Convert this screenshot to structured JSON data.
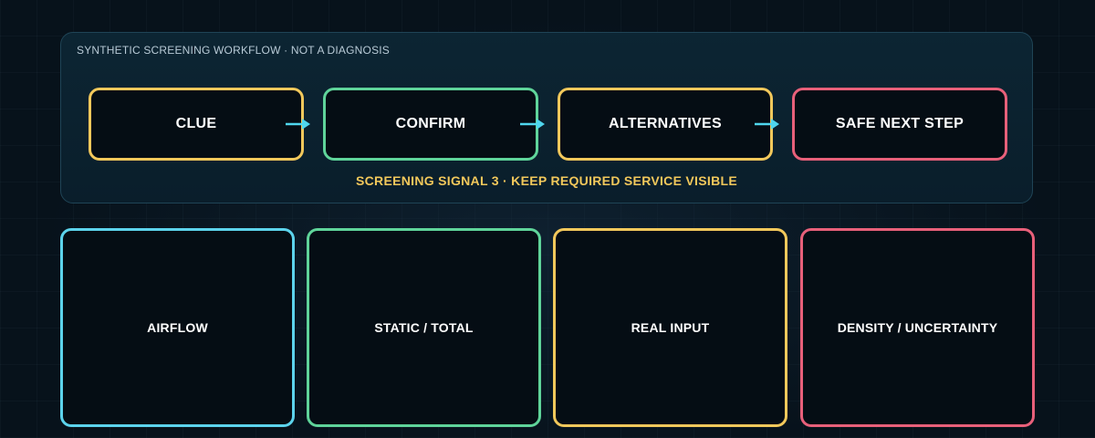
{
  "workflow": {
    "header": "SYNTHETIC SCREENING WORKFLOW · NOT A DIAGNOSIS",
    "steps": [
      {
        "label": "CLUE",
        "color": "#f2c85b"
      },
      {
        "label": "CONFIRM",
        "color": "#5fd49a"
      },
      {
        "label": "ALTERNATIVES",
        "color": "#f2c85b"
      },
      {
        "label": "SAFE NEXT STEP",
        "color": "#e8607a"
      }
    ],
    "arrow_color": "#4fd6ee",
    "signal": "SCREENING SIGNAL 3 · KEEP REQUIRED SERVICE VISIBLE",
    "signal_color": "#f2c85b"
  },
  "cards": [
    {
      "label": "AIRFLOW",
      "color": "#5cd3ec"
    },
    {
      "label": "STATIC / TOTAL",
      "color": "#5fd49a"
    },
    {
      "label": "REAL INPUT",
      "color": "#f2c85b"
    },
    {
      "label": "DENSITY / UNCERTAINTY",
      "color": "#e8607a"
    }
  ]
}
